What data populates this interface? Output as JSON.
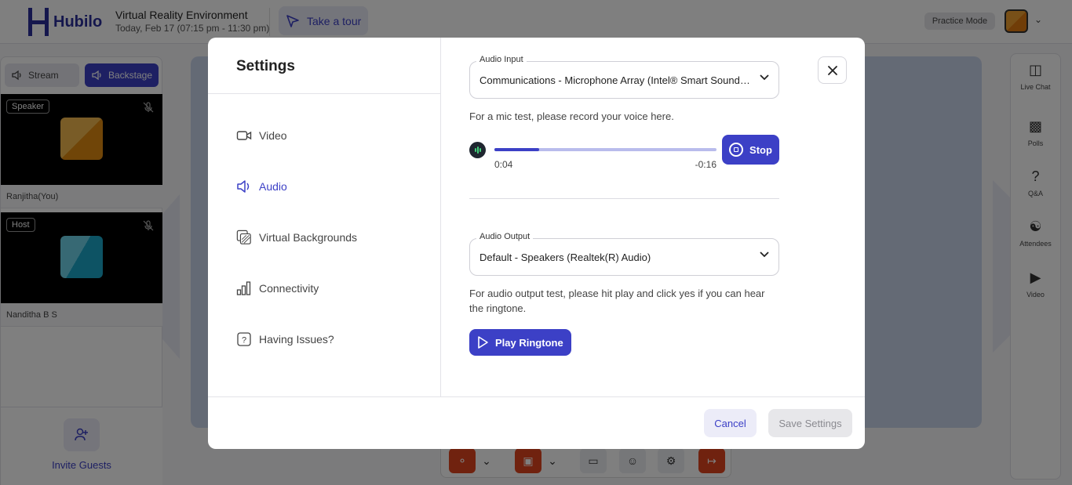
{
  "app": {
    "logo_text": "Hubilo",
    "event_title": "Virtual Reality Environment",
    "event_date": "Today, Feb 17 (07:15 pm - 11:30 pm)",
    "tour_label": "Take a tour",
    "practice_mode": "Practice Mode"
  },
  "left_panel": {
    "stream_tab": "Stream",
    "backstage_tab": "Backstage",
    "tiles": [
      {
        "badge": "Speaker",
        "name": "Ranjitha(You)"
      },
      {
        "badge": "Host",
        "name": "Nanditha B S"
      }
    ],
    "invite_label": "Invite Guests"
  },
  "right_rail": {
    "items": [
      {
        "label": "Live Chat",
        "icon": "chat-icon"
      },
      {
        "label": "Polls",
        "icon": "polls-icon"
      },
      {
        "label": "Q&A",
        "icon": "qa-icon"
      },
      {
        "label": "Attendees",
        "icon": "attendees-icon"
      },
      {
        "label": "Video",
        "icon": "video-icon"
      }
    ]
  },
  "modal": {
    "title": "Settings",
    "nav": [
      {
        "label": "Video",
        "icon": "camera-icon",
        "active": false
      },
      {
        "label": "Audio",
        "icon": "speaker-icon",
        "active": true
      },
      {
        "label": "Virtual Backgrounds",
        "icon": "background-icon",
        "active": false
      },
      {
        "label": "Connectivity",
        "icon": "signal-icon",
        "active": false
      },
      {
        "label": "Having Issues?",
        "icon": "help-icon",
        "active": false
      }
    ],
    "audio": {
      "input_legend": "Audio Input",
      "input_value": "Communications - Microphone Array (Intel® Smart Sound Technology)",
      "mic_test_text": "For a mic test, please record your voice here.",
      "elapsed": "0:04",
      "remaining": "-0:16",
      "progress": 0.2,
      "stop_label": "Stop",
      "output_legend": "Audio Output",
      "output_value": "Default - Speakers (Realtek(R) Audio)",
      "output_test_text": "For audio output test, please hit play and click yes if you can hear the ringtone.",
      "play_label": "Play Ringtone"
    },
    "footer": {
      "cancel_label": "Cancel",
      "save_label": "Save Settings"
    }
  },
  "colors": {
    "accent": "#3c40c6",
    "danger": "#e0441f"
  }
}
